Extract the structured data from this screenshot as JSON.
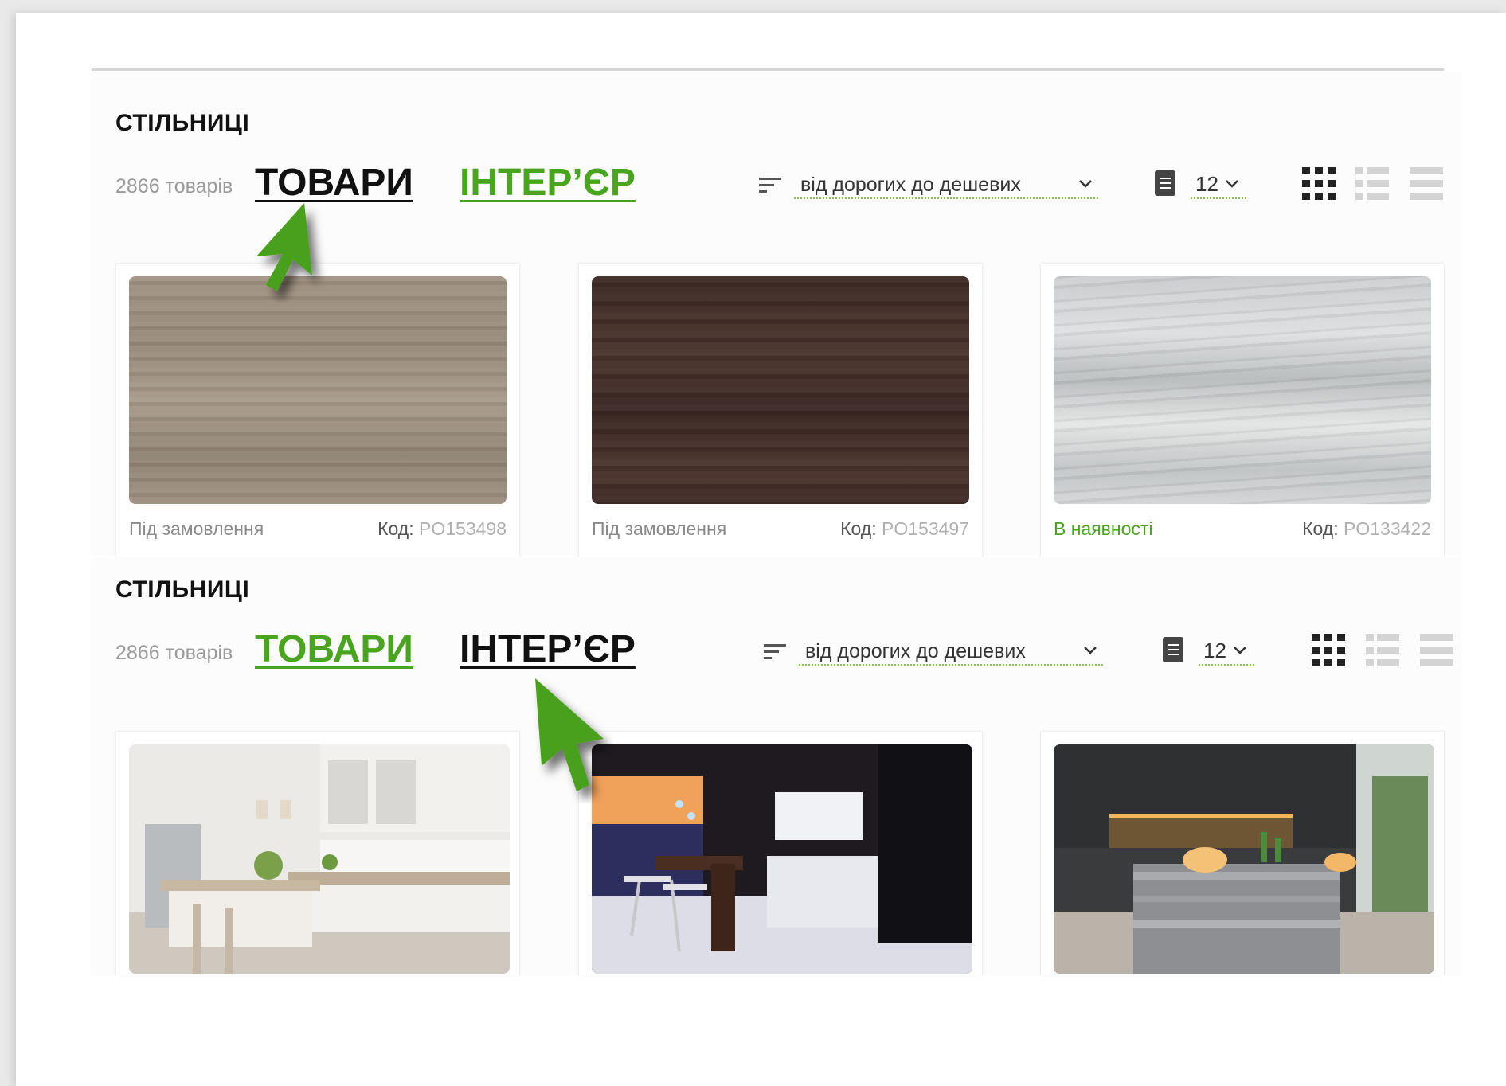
{
  "sections": [
    {
      "title": "СТІЛЬНИЦІ",
      "count": "2866 товарів",
      "tabs": [
        {
          "label": "ТОВАРИ",
          "active": true
        },
        {
          "label": "ІНТЕР’ЄР",
          "active": false
        }
      ],
      "sort_label": "від дорогих до дешевих",
      "per_page": "12",
      "products": [
        {
          "availability": "Під замовлення",
          "code_label": "Код:",
          "code": "PO153498",
          "texture": "light-grey-oak"
        },
        {
          "availability": "Під замовлення",
          "code_label": "Код:",
          "code": "PO153497",
          "texture": "dark-brown-oak"
        },
        {
          "availability": "В наявності",
          "code_label": "Код:",
          "code": "PO133422",
          "texture": "white-grey-pine"
        }
      ]
    },
    {
      "title": "СТІЛЬНИЦІ",
      "count": "2866 товарів",
      "tabs": [
        {
          "label": "ТОВАРИ",
          "active": false
        },
        {
          "label": "ІНТЕР’ЄР",
          "active": true
        }
      ],
      "sort_label": "від дорогих до дешевих",
      "per_page": "12",
      "interiors": [
        {
          "scene": "white-kitchen"
        },
        {
          "scene": "night-city-kitchen"
        },
        {
          "scene": "dark-kitchen-marble-island"
        }
      ]
    }
  ],
  "icons": {
    "sort": "sort-lines-icon",
    "per_page": "page-icon",
    "views": [
      "grid-view-icon",
      "list-view-icon",
      "rows-view-icon"
    ],
    "annotation": "green-arrow-icon"
  },
  "colors": {
    "accent_green": "#49a51d",
    "active_text": "#111111",
    "muted_text": "#9a9a9a"
  }
}
